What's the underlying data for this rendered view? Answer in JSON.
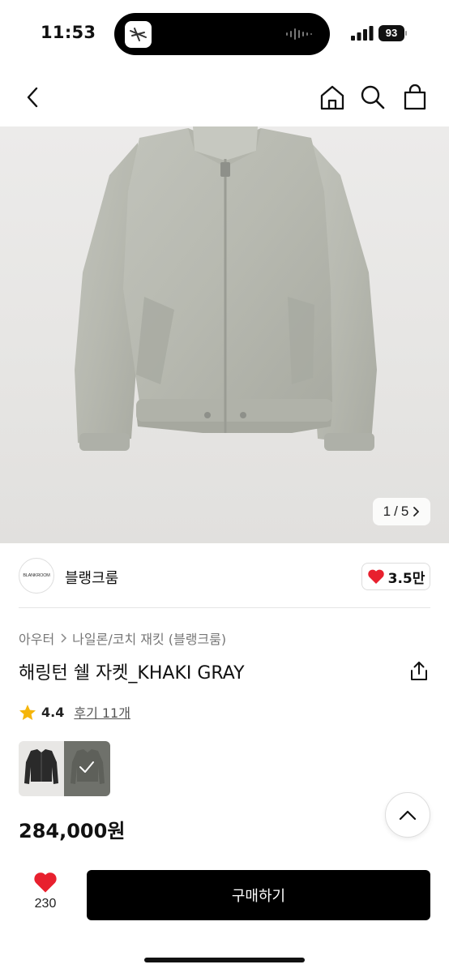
{
  "status_bar": {
    "time": "11:53",
    "battery": "93"
  },
  "nav": {
    "icons": [
      "chevron-left-icon",
      "home-icon",
      "search-icon",
      "shopping-bag-icon"
    ]
  },
  "product_image": {
    "counter_current": "1",
    "counter_sep": "/",
    "counter_total": "5",
    "bg_color": "#e6e5e3",
    "jacket_color": "#b8bab2"
  },
  "brand": {
    "logo_text": "BLANKROOM",
    "name": "블랭크룸",
    "likes": "3.5만"
  },
  "breadcrumb": {
    "category": "아우터",
    "subcategory": "나일론/코치 재킷 (블랭크룸)"
  },
  "product": {
    "title": "해링턴 쉘 자켓_KHAKI GRAY",
    "rating": "4.4",
    "reviews": "후기 11개",
    "price": "284,000원"
  },
  "swatches": [
    {
      "color": "black",
      "hex": "#2a2a2a"
    },
    {
      "color": "khaki gray",
      "hex": "#6f716b",
      "selected": true
    }
  ],
  "bottom_bar": {
    "wish_count": "230",
    "buy_label": "구매하기"
  },
  "colors": {
    "heart": "#e8202e",
    "star": "#f5b50a",
    "buy_bg": "#000000"
  }
}
